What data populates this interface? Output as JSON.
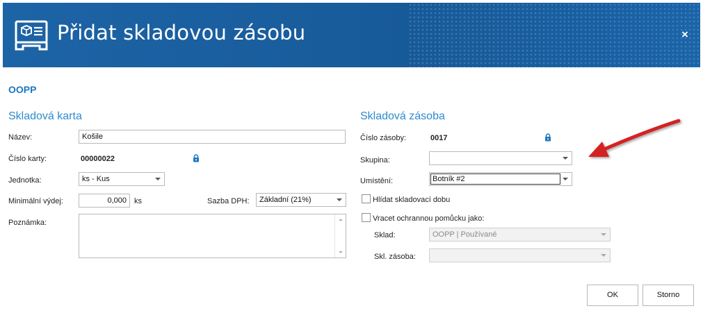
{
  "window": {
    "title": "Přidat skladovou zásobu",
    "close_label": "×"
  },
  "heading": "OOPP",
  "skladova_karta": {
    "section_title": "Skladová karta",
    "nazev_label": "Název:",
    "nazev_value": "Košile",
    "cislo_karty_label": "Číslo karty:",
    "cislo_karty_value": "00000022",
    "jednotka_label": "Jednotka:",
    "jednotka_value": "ks - Kus",
    "min_vydej_label": "Minimální výdej:",
    "min_vydej_value": "0,000",
    "min_vydej_unit": "ks",
    "sazba_dph_label": "Sazba DPH:",
    "sazba_dph_value": "Základní (21%)",
    "poznamka_label": "Poznámka:",
    "poznamka_value": ""
  },
  "skladova_zasoba": {
    "section_title": "Skladová zásoba",
    "cislo_zasoby_label": "Číslo zásoby:",
    "cislo_zasoby_value": "0017",
    "skupina_label": "Skupina:",
    "skupina_value": "",
    "umisteni_label": "Umístění:",
    "umisteni_value": "Botník #2",
    "hlidat_label": "Hlídat skladovací dobu",
    "hlidat_checked": false,
    "vracet_label": "Vracet ochrannou pomůcku jako:",
    "vracet_checked": false,
    "sklad_label": "Sklad:",
    "sklad_value": "OOPP | Používané",
    "skl_zasoba_label": "Skl. zásoba:",
    "skl_zasoba_value": ""
  },
  "buttons": {
    "ok": "OK",
    "storno": "Storno"
  },
  "colors": {
    "title_bar": "#1a5e9e",
    "accent": "#2d8ad0",
    "annotation_arrow": "#d42020"
  },
  "icons": [
    "inventory-box-icon",
    "lock-icon",
    "close-icon",
    "chevron-down-icon"
  ]
}
